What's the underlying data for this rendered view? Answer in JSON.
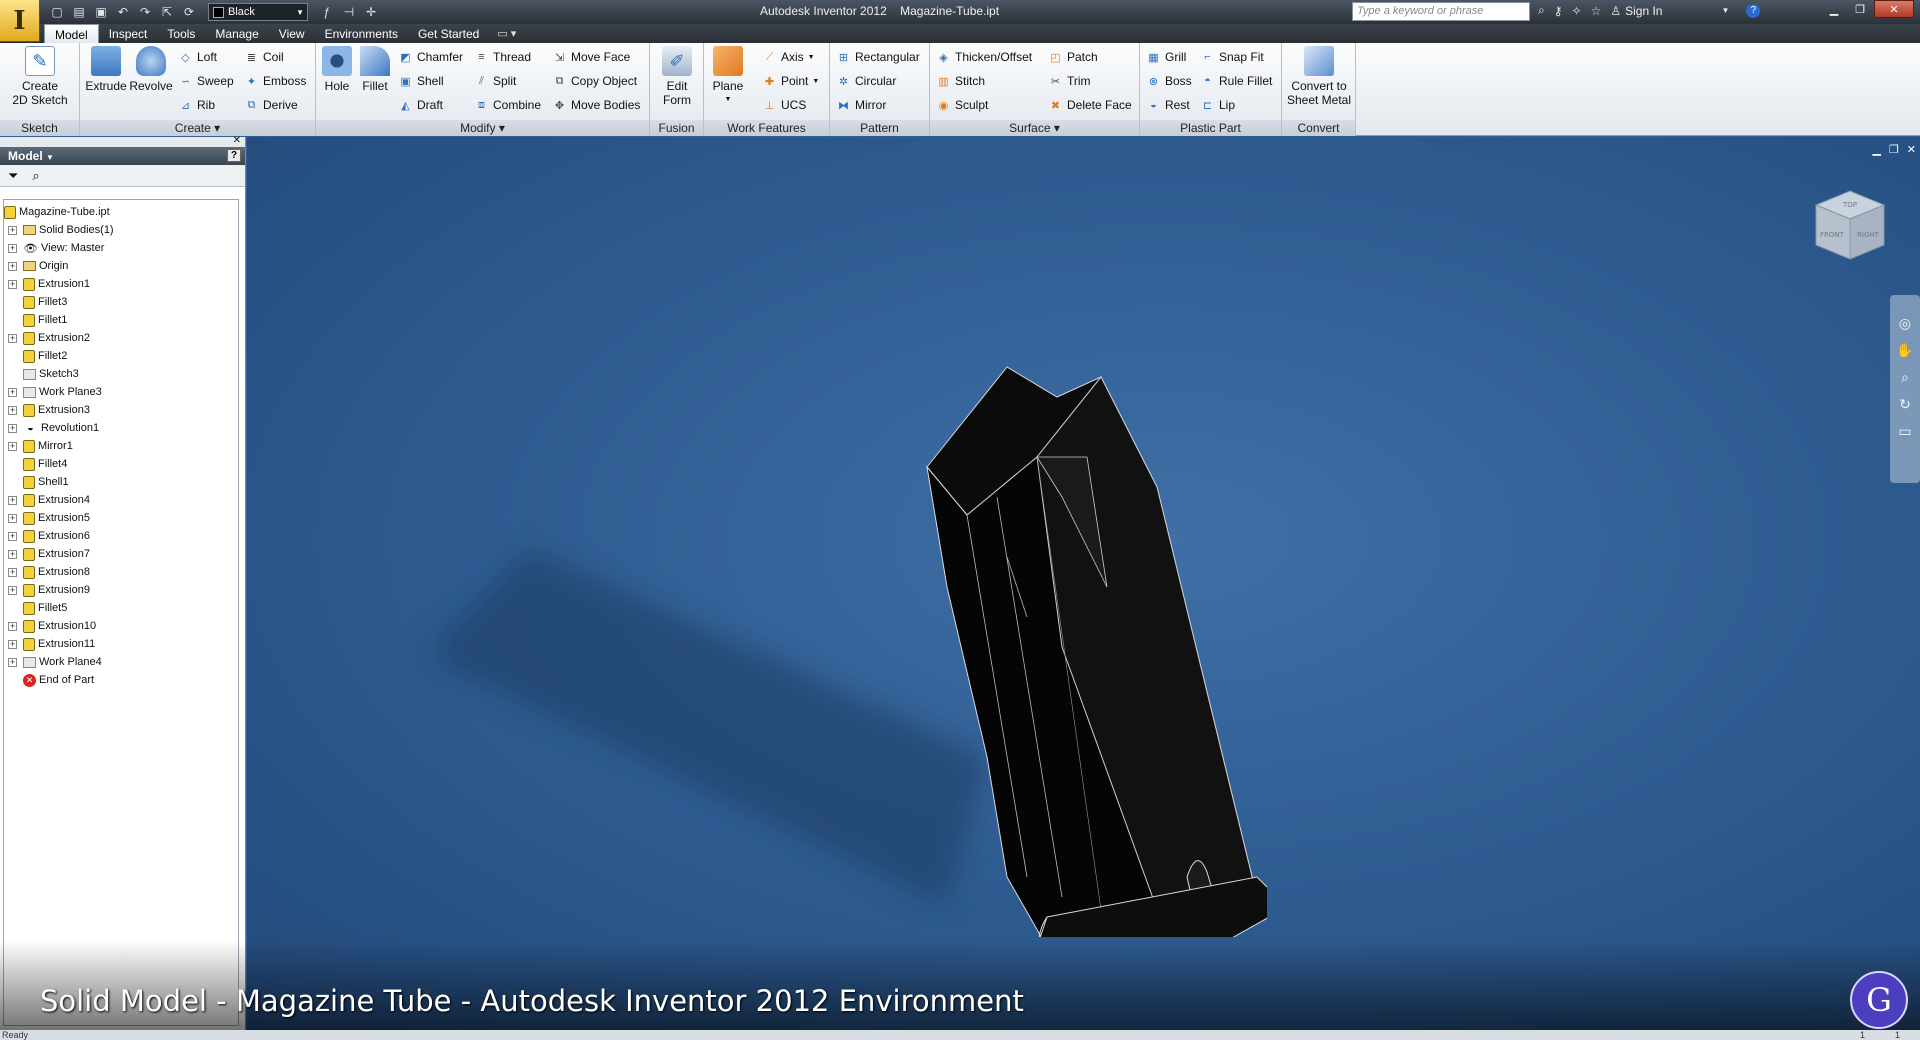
{
  "app": {
    "title": "Autodesk Inventor 2012",
    "document": "Magazine-Tube.ipt",
    "app_button_letter": "I"
  },
  "quick_access": {
    "color_value": "Black",
    "color_swatch": "#000000"
  },
  "titlebar": {
    "search_placeholder": "Type a keyword or phrase",
    "sign_in": "Sign In",
    "help": "?"
  },
  "tabs": {
    "items": [
      "Model",
      "Inspect",
      "Tools",
      "Manage",
      "View",
      "Environments",
      "Get Started"
    ],
    "active": "Model"
  },
  "ribbon": {
    "sketch": {
      "label": "Sketch",
      "create_2d_sketch": "Create\n2D Sketch"
    },
    "create": {
      "label": "Create",
      "extrude": "Extrude",
      "revolve": "Revolve",
      "loft": "Loft",
      "sweep": "Sweep",
      "rib": "Rib",
      "coil": "Coil",
      "emboss": "Emboss",
      "derive": "Derive"
    },
    "modify": {
      "label": "Modify",
      "hole": "Hole",
      "fillet": "Fillet",
      "chamfer": "Chamfer",
      "shell": "Shell",
      "draft": "Draft",
      "thread": "Thread",
      "split": "Split",
      "combine": "Combine",
      "move_face": "Move Face",
      "copy_object": "Copy Object",
      "move_bodies": "Move Bodies"
    },
    "fusion": {
      "label": "Fusion",
      "edit_form": "Edit\nForm"
    },
    "work_features": {
      "label": "Work Features",
      "plane": "Plane",
      "axis": "Axis",
      "point": "Point",
      "ucs": "UCS"
    },
    "pattern": {
      "label": "Pattern",
      "rectangular": "Rectangular",
      "circular": "Circular",
      "mirror": "Mirror"
    },
    "surface": {
      "label": "Surface",
      "thicken_offset": "Thicken/Offset",
      "stitch": "Stitch",
      "sculpt": "Sculpt",
      "patch": "Patch",
      "trim": "Trim",
      "delete_face": "Delete Face"
    },
    "plastic_part": {
      "label": "Plastic Part",
      "grill": "Grill",
      "boss": "Boss",
      "rest": "Rest",
      "snap_fit": "Snap Fit",
      "rule_fillet": "Rule Fillet",
      "lip": "Lip"
    },
    "convert": {
      "label": "Convert",
      "convert_to_sheet_metal": "Convert to\nSheet Metal"
    }
  },
  "browser": {
    "title": "Model",
    "help": "?",
    "tree": [
      {
        "label": "Magazine-Tube.ipt",
        "icon": "part-icon",
        "expandable": false,
        "root": true
      },
      {
        "label": "Solid Bodies(1)",
        "icon": "solid-bodies-icon",
        "expandable": true
      },
      {
        "label": "View: Master",
        "icon": "view-icon",
        "expandable": true
      },
      {
        "label": "Origin",
        "icon": "folder-icon",
        "expandable": true
      },
      {
        "label": "Extrusion1",
        "icon": "extrusion-icon",
        "expandable": true
      },
      {
        "label": "Fillet3",
        "icon": "fillet-icon",
        "expandable": false
      },
      {
        "label": "Fillet1",
        "icon": "fillet-icon",
        "expandable": false
      },
      {
        "label": "Extrusion2",
        "icon": "extrusion-icon",
        "expandable": true
      },
      {
        "label": "Fillet2",
        "icon": "fillet-icon",
        "expandable": false
      },
      {
        "label": "Sketch3",
        "icon": "sketch-icon",
        "expandable": false
      },
      {
        "label": "Work Plane3",
        "icon": "work-plane-icon",
        "expandable": true
      },
      {
        "label": "Extrusion3",
        "icon": "extrusion-icon",
        "expandable": true
      },
      {
        "label": "Revolution1",
        "icon": "revolve-icon",
        "expandable": true
      },
      {
        "label": "Mirror1",
        "icon": "mirror-icon",
        "expandable": true
      },
      {
        "label": "Fillet4",
        "icon": "fillet-icon",
        "expandable": false
      },
      {
        "label": "Shell1",
        "icon": "shell-icon",
        "expandable": false
      },
      {
        "label": "Extrusion4",
        "icon": "extrusion-icon",
        "expandable": true
      },
      {
        "label": "Extrusion5",
        "icon": "extrusion-icon",
        "expandable": true
      },
      {
        "label": "Extrusion6",
        "icon": "extrusion-icon",
        "expandable": true
      },
      {
        "label": "Extrusion7",
        "icon": "extrusion-icon",
        "expandable": true
      },
      {
        "label": "Extrusion8",
        "icon": "extrusion-icon",
        "expandable": true
      },
      {
        "label": "Extrusion9",
        "icon": "extrusion-icon",
        "expandable": true
      },
      {
        "label": "Fillet5",
        "icon": "fillet-icon",
        "expandable": false
      },
      {
        "label": "Extrusion10",
        "icon": "extrusion-icon",
        "expandable": true
      },
      {
        "label": "Extrusion11",
        "icon": "extrusion-icon",
        "expandable": true
      },
      {
        "label": "Work Plane4",
        "icon": "work-plane-icon",
        "expandable": true
      },
      {
        "label": "End of Part",
        "icon": "end-of-part-icon",
        "expandable": false
      }
    ]
  },
  "viewport": {
    "background": "#2f5f94",
    "viewcube_faces": [
      "TOP",
      "FRONT",
      "RIGHT"
    ]
  },
  "caption": {
    "text": "Solid Model - Magazine Tube - Autodesk Inventor 2012 Environment",
    "logo_letter": "G"
  },
  "statusbar": {
    "text": "Ready",
    "num1": "1",
    "num2": "1"
  }
}
